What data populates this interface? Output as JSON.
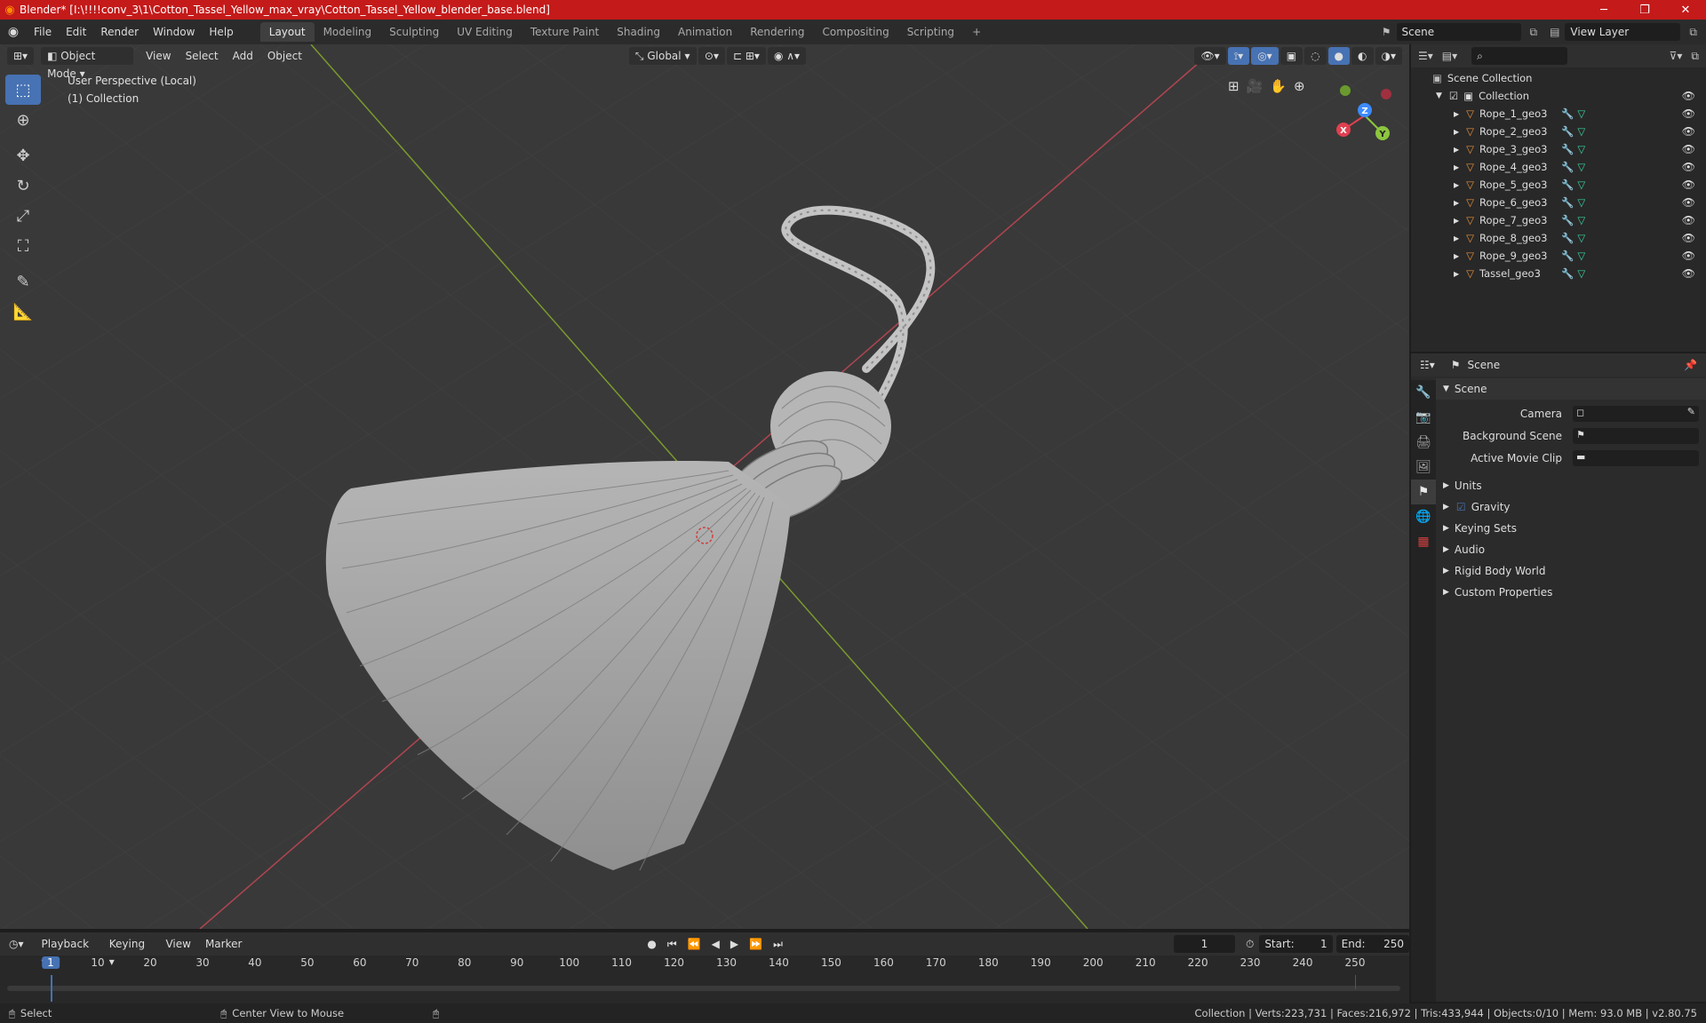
{
  "window": {
    "title": "Blender* [I:\\!!!!conv_3\\1\\Cotton_Tassel_Yellow_max_vray\\Cotton_Tassel_Yellow_blender_base.blend]",
    "minimize": "─",
    "maximize": "❐",
    "close": "✕"
  },
  "menus": [
    "File",
    "Edit",
    "Render",
    "Window",
    "Help"
  ],
  "workspaces": [
    "Layout",
    "Modeling",
    "Sculpting",
    "UV Editing",
    "Texture Paint",
    "Shading",
    "Animation",
    "Rendering",
    "Compositing",
    "Scripting",
    "+"
  ],
  "scene_selector": "Scene",
  "view_layer": "View Layer",
  "viewport": {
    "mode": "Object Mode",
    "menus": [
      "View",
      "Select",
      "Add",
      "Object"
    ],
    "transform_orientation": "Global",
    "perspective_label": "User Perspective (Local)",
    "collection_label": "(1) Collection",
    "gizmo": {
      "x": "X",
      "y": "Y",
      "z": "Z"
    }
  },
  "outliner": {
    "root": "Scene Collection",
    "collection": "Collection",
    "objects": [
      "Rope_1_geo3",
      "Rope_2_geo3",
      "Rope_3_geo3",
      "Rope_4_geo3",
      "Rope_5_geo3",
      "Rope_6_geo3",
      "Rope_7_geo3",
      "Rope_8_geo3",
      "Rope_9_geo3",
      "Tassel_geo3"
    ]
  },
  "properties": {
    "header": "Scene",
    "panel_title": "Scene",
    "camera_label": "Camera",
    "background_scene_label": "Background Scene",
    "active_movie_clip_label": "Active Movie Clip",
    "sections": [
      "Units",
      "Gravity",
      "Keying Sets",
      "Audio",
      "Rigid Body World",
      "Custom Properties"
    ]
  },
  "timeline": {
    "menus": [
      "Playback",
      "Keying",
      "View",
      "Marker"
    ],
    "current_frame": "1",
    "start_label": "Start:",
    "start": "1",
    "end_label": "End:",
    "end": "250",
    "ticks": [
      "1",
      "10",
      "20",
      "30",
      "40",
      "50",
      "60",
      "70",
      "80",
      "90",
      "100",
      "110",
      "120",
      "130",
      "140",
      "150",
      "160",
      "170",
      "180",
      "190",
      "200",
      "210",
      "220",
      "230",
      "240",
      "250"
    ]
  },
  "status": {
    "select": "Select",
    "center_view": "Center View to Mouse",
    "stats": "Collection | Verts:223,731 | Faces:216,972 | Tris:433,944 | Objects:0/10 | Mem: 93.0 MB | v2.80.75"
  },
  "colors": {
    "accent": "#4772b3",
    "title_bar": "#c41a1a",
    "x_axis": "#e04050",
    "y_axis": "#8cc63f",
    "z_axis": "#3d8bff",
    "mesh_icon": "#e8913a",
    "modifier_icon": "#4aa3ff",
    "data_icon": "#3ad4a0"
  }
}
